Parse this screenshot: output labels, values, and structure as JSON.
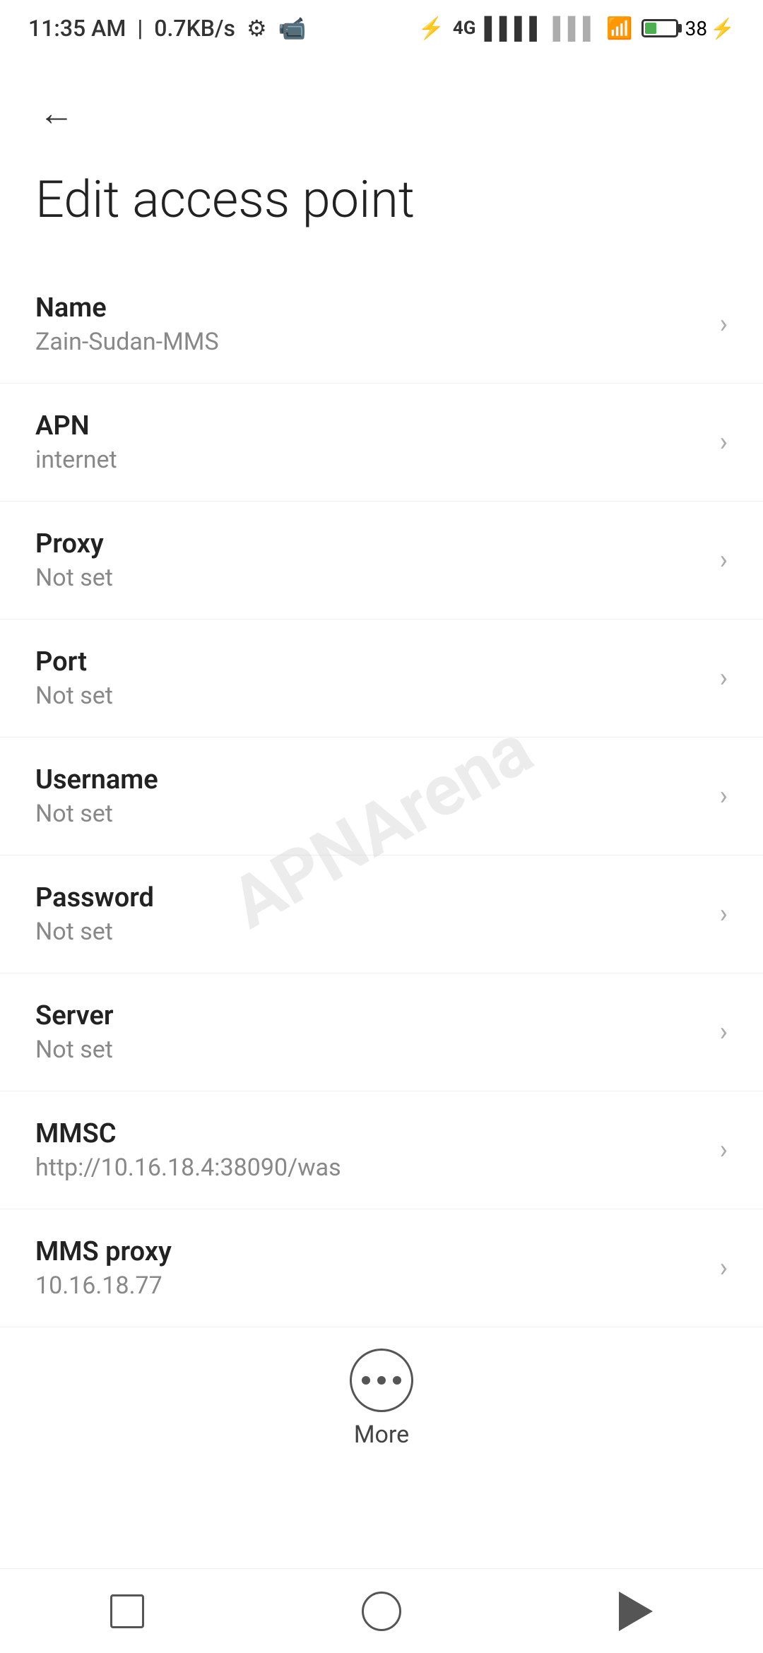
{
  "statusBar": {
    "time": "11:35 AM",
    "speed": "0.7KB/s"
  },
  "header": {
    "backLabel": "←",
    "title": "Edit access point"
  },
  "settings": [
    {
      "id": "name",
      "label": "Name",
      "value": "Zain-Sudan-MMS"
    },
    {
      "id": "apn",
      "label": "APN",
      "value": "internet"
    },
    {
      "id": "proxy",
      "label": "Proxy",
      "value": "Not set"
    },
    {
      "id": "port",
      "label": "Port",
      "value": "Not set"
    },
    {
      "id": "username",
      "label": "Username",
      "value": "Not set"
    },
    {
      "id": "password",
      "label": "Password",
      "value": "Not set"
    },
    {
      "id": "server",
      "label": "Server",
      "value": "Not set"
    },
    {
      "id": "mmsc",
      "label": "MMSC",
      "value": "http://10.16.18.4:38090/was"
    },
    {
      "id": "mms-proxy",
      "label": "MMS proxy",
      "value": "10.16.18.77"
    }
  ],
  "more": {
    "label": "More"
  },
  "watermark": "APNArena"
}
